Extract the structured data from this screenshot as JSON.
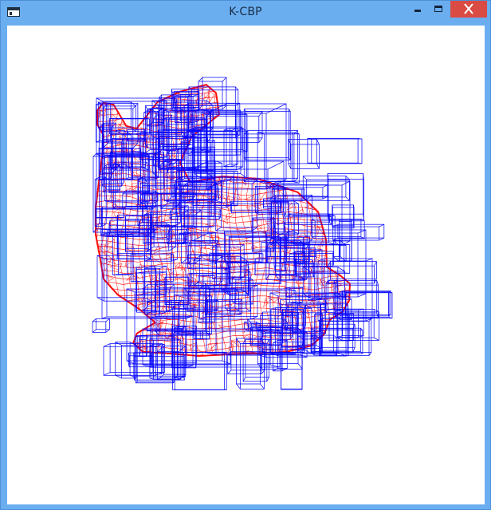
{
  "window": {
    "title": "K-CBP",
    "icon": "app-window-icon",
    "controls": {
      "minimize": "minimize-icon",
      "maximize": "maximize-icon",
      "close": "close-icon"
    }
  },
  "viewport": {
    "background_color": "#ffffff",
    "mesh_color": "#ff0000",
    "box_color": "#0000ff"
  },
  "colors": {
    "titlebar": "#6aaef0",
    "close_button": "#d94b43"
  }
}
